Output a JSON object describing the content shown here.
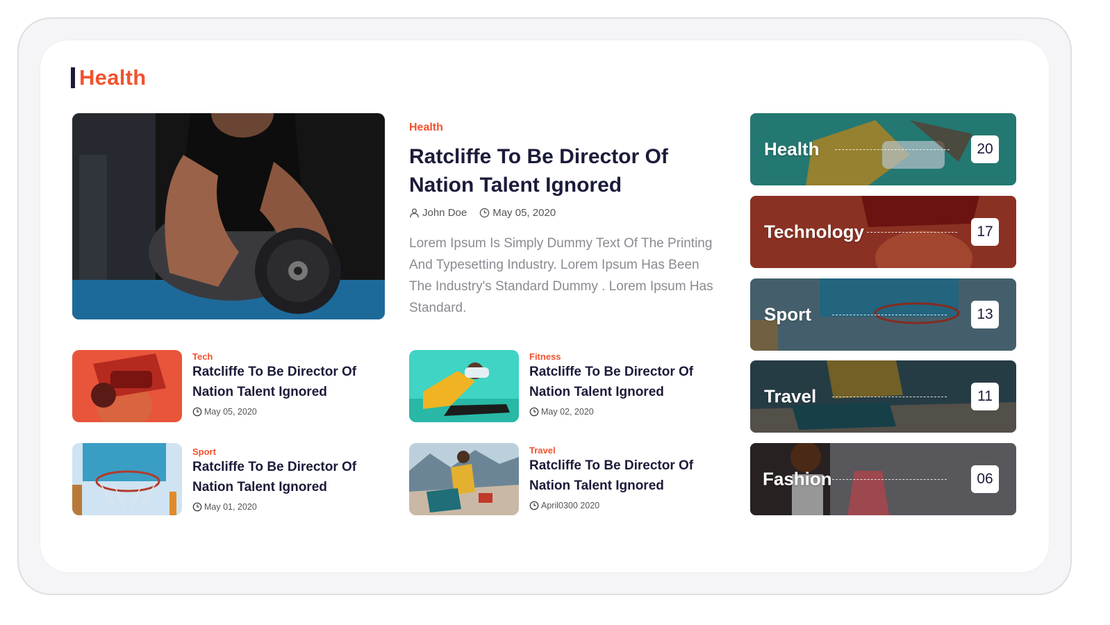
{
  "section": {
    "title": "Health"
  },
  "featured": {
    "category": "Health",
    "title": "Ratcliffe To Be Director Of Nation Talent Ignored",
    "author": "John Doe",
    "date": "May 05, 2020",
    "description": "Lorem Ipsum Is Simply Dummy Text Of The Printing And Typesetting Industry. Lorem Ipsum Has Been The Industry's Standard Dummy . Lorem Ipsum Has Standard.",
    "image_icon": "dumbbell-workout-photo"
  },
  "articles": [
    {
      "category": "Tech",
      "title": "Ratcliffe To Be Director Of Nation Talent Ignored",
      "date": "May 05, 2020",
      "image_icon": "vr-headset-photo"
    },
    {
      "category": "Fitness",
      "title": "Ratcliffe To Be Director Of Nation Talent Ignored",
      "date": "May 02, 2020",
      "image_icon": "stretching-photo"
    },
    {
      "category": "Sport",
      "title": "Ratcliffe To Be Director Of Nation Talent Ignored",
      "date": "May 01, 2020",
      "image_icon": "basketball-hoop-photo"
    },
    {
      "category": "Travel",
      "title": "Ratcliffe To Be Director Of Nation Talent Ignored",
      "date": "April0300 2020",
      "image_icon": "hiker-mountains-photo"
    }
  ],
  "categories": [
    {
      "label": "Health",
      "count": "20",
      "color": "#2f8f86"
    },
    {
      "label": "Technology",
      "count": "17",
      "color": "#9c3a2c"
    },
    {
      "label": "Sport",
      "count": "13",
      "color": "#4a6f80"
    },
    {
      "label": "Travel",
      "count": "11",
      "color": "#2f4b55"
    },
    {
      "label": "Fashion",
      "count": "06",
      "color": "#3a3a42"
    }
  ],
  "colors": {
    "accent": "#f2522e",
    "heading": "#1b1b3a",
    "body_text": "#8a8a92"
  }
}
